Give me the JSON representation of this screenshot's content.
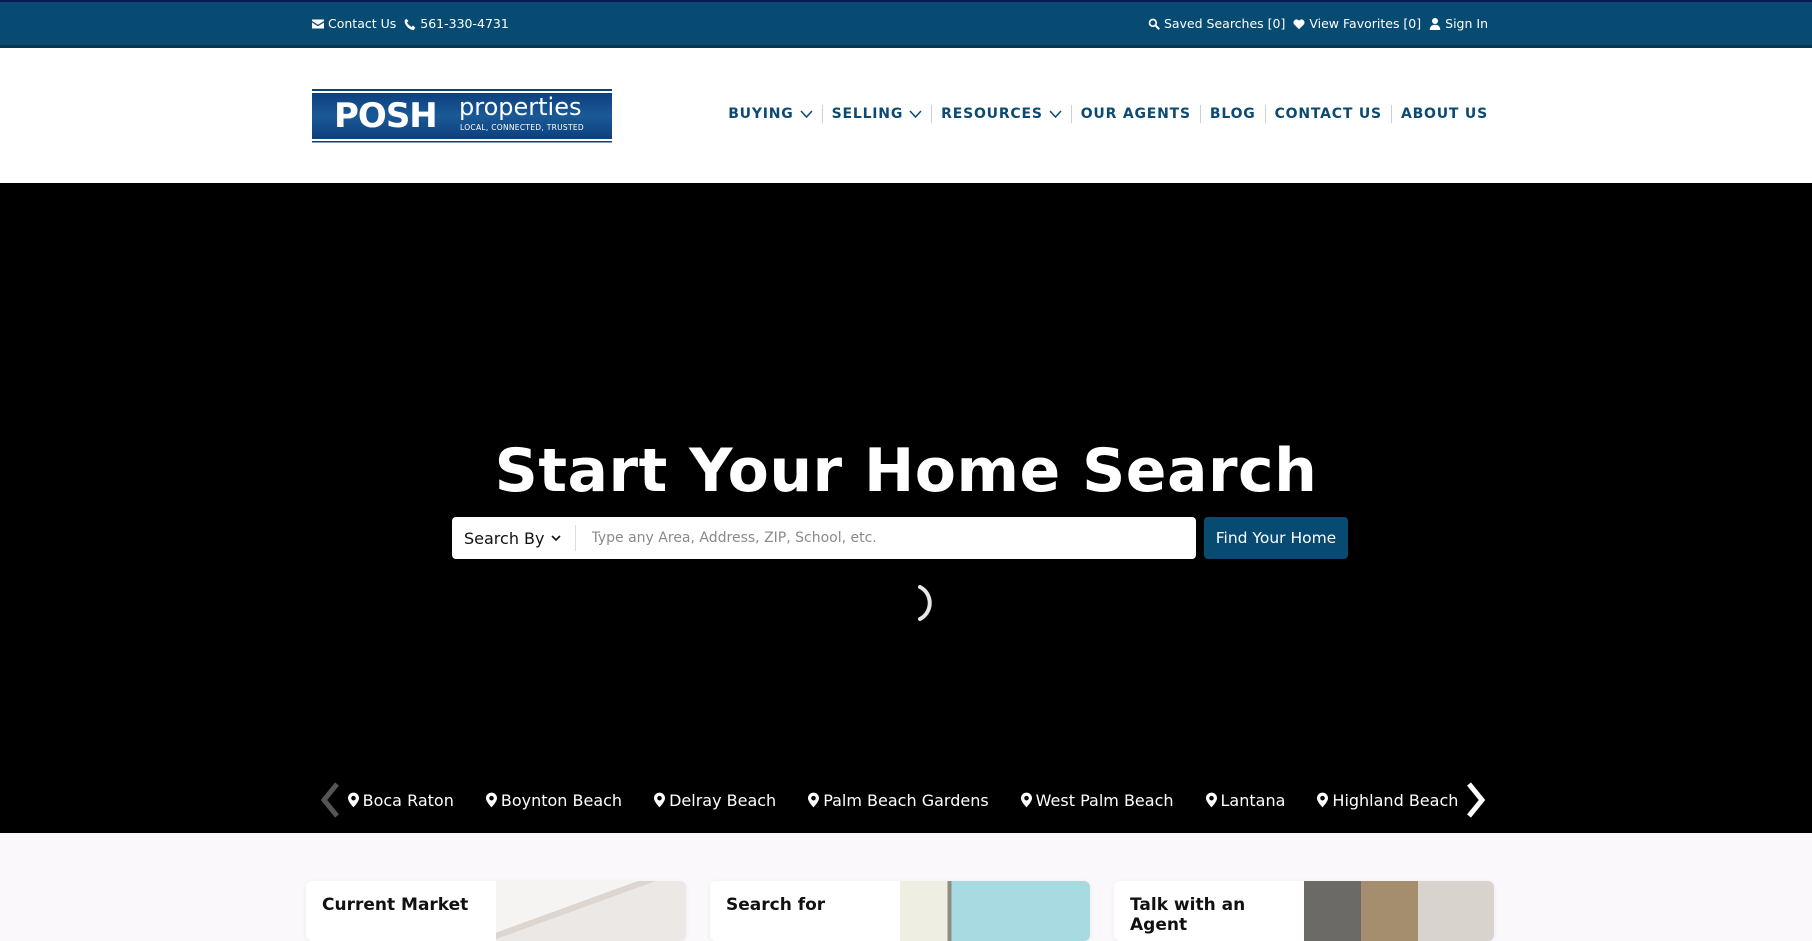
{
  "topbar": {
    "contact_label": "Contact Us",
    "phone": "561-330-4731",
    "saved_searches": "Saved Searches [0]",
    "favorites": "View Favorites [0]",
    "sign_in": "Sign In"
  },
  "logo": {
    "brand": "POSH",
    "sub": "properties",
    "tagline": "LOCAL, CONNECTED, TRUSTED"
  },
  "nav": [
    {
      "label": "BUYING",
      "dropdown": true
    },
    {
      "label": "SELLING",
      "dropdown": true
    },
    {
      "label": "RESOURCES",
      "dropdown": true
    },
    {
      "label": "OUR AGENTS",
      "dropdown": false
    },
    {
      "label": "BLOG",
      "dropdown": false
    },
    {
      "label": "CONTACT US",
      "dropdown": false
    },
    {
      "label": "ABOUT US",
      "dropdown": false
    }
  ],
  "hero": {
    "title": "Start Your Home Search",
    "search_by_label": "Search By",
    "search_placeholder": "Type any Area, Address, ZIP, School, etc.",
    "search_value": "",
    "find_button": "Find Your Home"
  },
  "cities": [
    "Boca Raton",
    "Boynton Beach",
    "Delray Beach",
    "Palm Beach Gardens",
    "West Palm Beach",
    "Lantana",
    "Highland Beach"
  ],
  "cards": [
    {
      "title": "Current Market"
    },
    {
      "title": "Search for"
    },
    {
      "title": "Talk with an Agent"
    }
  ],
  "colors": {
    "brand": "#074b72",
    "hero_bg": "#000000",
    "nav_text": "#0c4a72"
  }
}
